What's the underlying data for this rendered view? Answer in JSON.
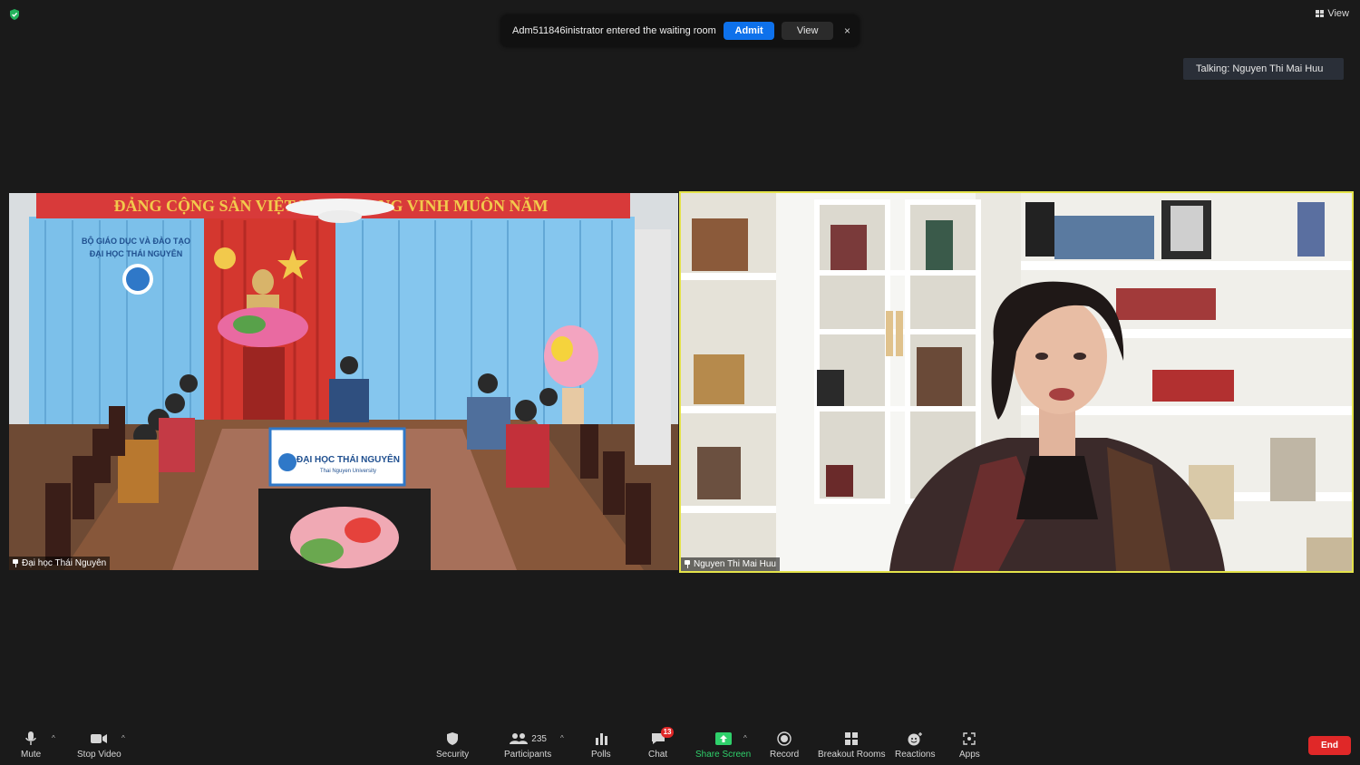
{
  "topbar": {
    "view_label": "View"
  },
  "notification": {
    "message": "Adm511846inistrator entered the waiting room",
    "admit_label": "Admit",
    "view_label": "View",
    "close_glyph": "×"
  },
  "talking": {
    "label": "Talking: Nguyen Thi Mai Huu"
  },
  "tiles": {
    "left": {
      "name": "Đại học Thái Nguyên",
      "banner_text": "ĐẢNG CỘNG SẢN VIỆT NAM QUANG VINH MUÔN NĂM",
      "wall_text_1": "BỘ GIÁO DỤC VÀ ĐÀO TẠO",
      "wall_text_2": "ĐẠI HỌC THÁI NGUYÊN",
      "sign_title": "ĐẠI HỌC THÁI NGUYÊN",
      "sign_subtitle": "Thai Nguyen University"
    },
    "right": {
      "name": "Nguyen Thi Mai Huu",
      "active_speaker_color": "#e4e34a"
    }
  },
  "toolbar": {
    "mute": "Mute",
    "stop_video": "Stop Video",
    "security": "Security",
    "participants": "Participants",
    "participants_count": "235",
    "polls": "Polls",
    "chat": "Chat",
    "chat_badge": "13",
    "share_screen": "Share Screen",
    "record": "Record",
    "breakout_rooms": "Breakout Rooms",
    "reactions": "Reactions",
    "apps": "Apps",
    "end": "End"
  },
  "colors": {
    "accent_blue": "#0e71eb",
    "end_red": "#e02828",
    "share_green": "#2fd06b",
    "shield_green": "#23b35c"
  }
}
